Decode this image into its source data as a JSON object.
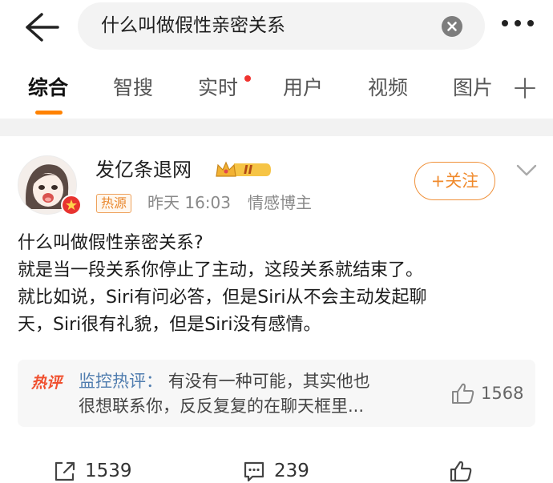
{
  "search": {
    "query": "什么叫做假性亲密关系"
  },
  "tabs": [
    {
      "label": "综合",
      "active": true
    },
    {
      "label": "智搜",
      "active": false
    },
    {
      "label": "实时",
      "active": false,
      "has_dot": true
    },
    {
      "label": "用户",
      "active": false
    },
    {
      "label": "视频",
      "active": false
    },
    {
      "label": "图片",
      "active": false
    }
  ],
  "post": {
    "author": "发亿条退网",
    "vip_badge": "II",
    "tag": "热源",
    "time": "昨天 16:03",
    "role": "情感博主",
    "follow_label": "+关注",
    "body_lines": [
      "什么叫做假性亲密关系?",
      "就是当一段关系你停止了主动，这段关系就结束了。",
      "就比如说，Siri有问必答，但是Siri从不会主动发起聊",
      "天，Siri很有礼貌，但是Siri没有感情。"
    ]
  },
  "hot_comment": {
    "logo": "热评",
    "author": "监控热评：",
    "line1": "有没有一种可能，其实他也",
    "line2": "很想联系你，反反复复的在聊天框里...",
    "likes": "1568"
  },
  "footer": {
    "reposts": "1539",
    "comments": "239"
  },
  "colors": {
    "accent": "#ff8200",
    "follow": "#f08a2c",
    "hot_red": "#f0502f",
    "link_blue": "#507daf",
    "dot_red": "#f0332f"
  }
}
